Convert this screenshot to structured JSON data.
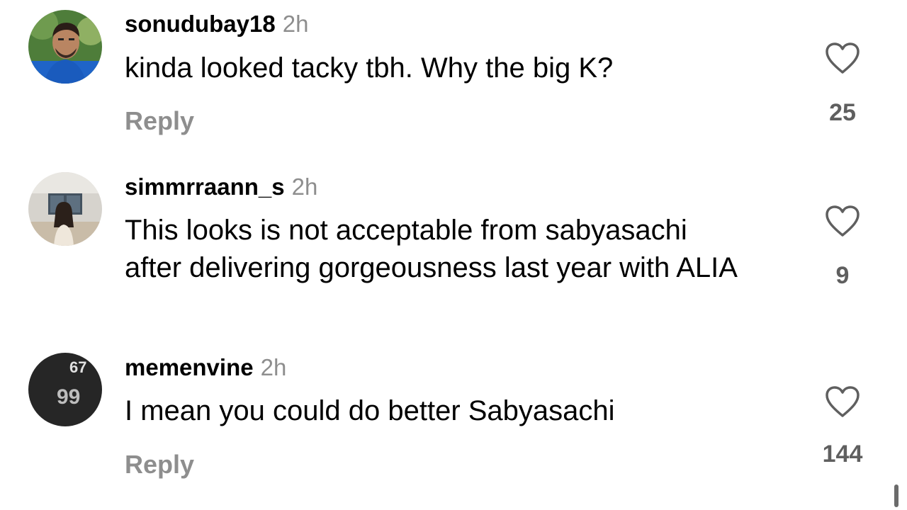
{
  "comments": [
    {
      "username": "sonudubay18",
      "time": "2h",
      "text": "kinda looked tacky tbh. Why the big K?",
      "reply_label": "Reply",
      "likes": "25",
      "avatar_icon": "profile-photo-man-blue-shirt"
    },
    {
      "username": "simmrraann_s",
      "time": "2h",
      "text": "This looks is not acceptable from sabyasachi after delivering gorgeousness last year with ALIA",
      "likes": "9",
      "avatar_icon": "profile-photo-woman-room"
    },
    {
      "username": "memenvine",
      "time": "2h",
      "text": "I mean you could do better Sabyasachi",
      "reply_label": "Reply",
      "likes": "144",
      "avatar_icon": "profile-logo-dark-circle"
    }
  ],
  "colors": {
    "text": "#000000",
    "secondary": "#8e8e8e",
    "count": "#5f5f5f"
  }
}
